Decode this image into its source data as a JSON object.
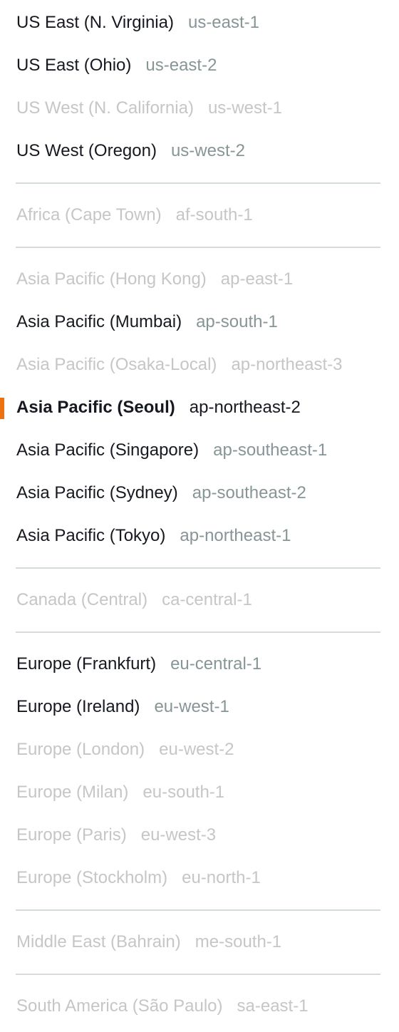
{
  "groups": [
    {
      "items": [
        {
          "name": "US East (N. Virginia)",
          "code": "us-east-1",
          "state": "enabled"
        },
        {
          "name": "US East (Ohio)",
          "code": "us-east-2",
          "state": "enabled"
        },
        {
          "name": "US West (N. California)",
          "code": "us-west-1",
          "state": "disabled"
        },
        {
          "name": "US West (Oregon)",
          "code": "us-west-2",
          "state": "enabled"
        }
      ]
    },
    {
      "items": [
        {
          "name": "Africa (Cape Town)",
          "code": "af-south-1",
          "state": "disabled"
        }
      ]
    },
    {
      "items": [
        {
          "name": "Asia Pacific (Hong Kong)",
          "code": "ap-east-1",
          "state": "disabled"
        },
        {
          "name": "Asia Pacific (Mumbai)",
          "code": "ap-south-1",
          "state": "enabled"
        },
        {
          "name": "Asia Pacific (Osaka-Local)",
          "code": "ap-northeast-3",
          "state": "disabled"
        },
        {
          "name": "Asia Pacific (Seoul)",
          "code": "ap-northeast-2",
          "state": "selected"
        },
        {
          "name": "Asia Pacific (Singapore)",
          "code": "ap-southeast-1",
          "state": "enabled"
        },
        {
          "name": "Asia Pacific (Sydney)",
          "code": "ap-southeast-2",
          "state": "enabled"
        },
        {
          "name": "Asia Pacific (Tokyo)",
          "code": "ap-northeast-1",
          "state": "enabled"
        }
      ]
    },
    {
      "items": [
        {
          "name": "Canada (Central)",
          "code": "ca-central-1",
          "state": "disabled"
        }
      ]
    },
    {
      "items": [
        {
          "name": "Europe (Frankfurt)",
          "code": "eu-central-1",
          "state": "enabled"
        },
        {
          "name": "Europe (Ireland)",
          "code": "eu-west-1",
          "state": "enabled"
        },
        {
          "name": "Europe (London)",
          "code": "eu-west-2",
          "state": "disabled"
        },
        {
          "name": "Europe (Milan)",
          "code": "eu-south-1",
          "state": "disabled"
        },
        {
          "name": "Europe (Paris)",
          "code": "eu-west-3",
          "state": "disabled"
        },
        {
          "name": "Europe (Stockholm)",
          "code": "eu-north-1",
          "state": "disabled"
        }
      ]
    },
    {
      "items": [
        {
          "name": "Middle East (Bahrain)",
          "code": "me-south-1",
          "state": "disabled"
        }
      ]
    },
    {
      "items": [
        {
          "name": "South America (São Paulo)",
          "code": "sa-east-1",
          "state": "disabled"
        }
      ]
    }
  ],
  "colors": {
    "selected_accent": "#ec7211",
    "text_enabled": "#16191f",
    "code_enabled": "#879596",
    "text_disabled": "#c6c6c6",
    "divider": "#d5dbdb"
  }
}
